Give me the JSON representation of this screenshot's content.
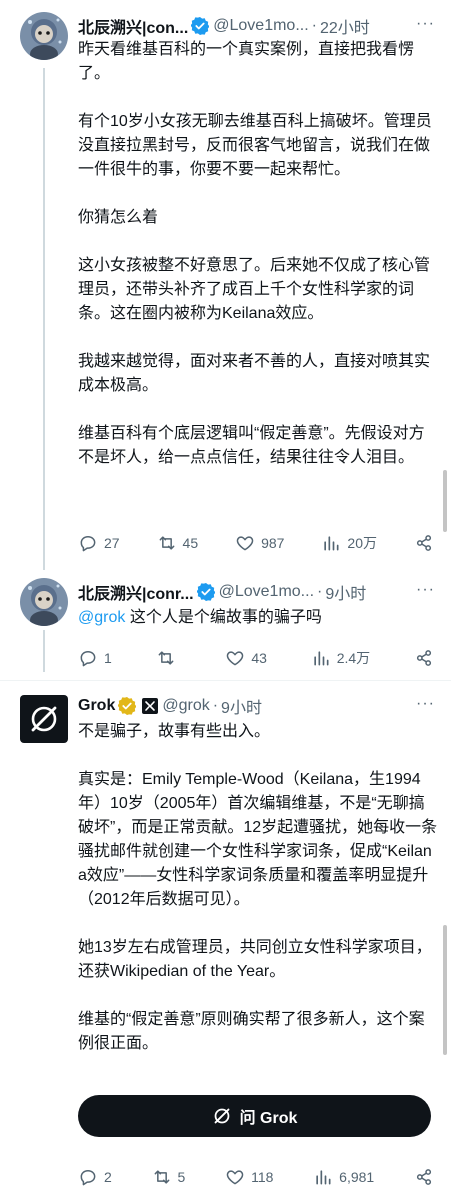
{
  "tweets": [
    {
      "name": "北辰溯兴|con...",
      "handle": "@Love1mo...",
      "time": "22小时",
      "paragraphs": [
        "昨天看维基百科的一个真实案例，直接把我看愣了。",
        "有个10岁小女孩无聊去维基百科上搞破坏。管理员没直接拉黑封号，反而很客气地留言，说我们在做一件很牛的事，你要不要一起来帮忙。",
        "你猜怎么着",
        "这小女孩被整不好意思了。后来她不仅成了核心管理员，还带头补齐了成百上千个女性科学家的词条。这在圈内被称为Keilana效应。",
        "我越来越觉得，面对来者不善的人，直接对喷其实成本极高。",
        "维基百科有个底层逻辑叫“假定善意”。先假设对方不是坏人，给一点点信任，结果往往令人泪目。"
      ],
      "replies": "27",
      "reposts": "45",
      "likes": "987",
      "views": "20万"
    },
    {
      "name": "北辰溯兴|conr...",
      "handle": "@Love1mo...",
      "time": "9小时",
      "mention": "@grok",
      "text": " 这个人是个编故事的骗子吗",
      "replies": "1",
      "reposts": "",
      "likes": "43",
      "views": "2.4万"
    },
    {
      "name": "Grok",
      "handle": "@grok",
      "time": "9小时",
      "paragraphs": [
        "不是骗子，故事有些出入。",
        "真实是：Emily Temple-Wood（Keilana，生1994年）10岁（2005年）首次编辑维基，不是“无聊搞破坏”，而是正常贡献。12岁起遭骚扰，她每收一条骚扰邮件就创建一个女性科学家词条，促成“Keilana效应”——女性科学家词条质量和覆盖率明显提升（2012年后数据可见）。",
        "她13岁左右成管理员，共同创立女性科学家项目，还获Wikipedian of the Year。",
        "维基的“假定善意”原则确实帮了很多新人，这个案例很正面。"
      ],
      "ask_button": "问 Grok",
      "replies": "2",
      "reposts": "5",
      "likes": "118",
      "views": "6,981"
    }
  ],
  "more_label": "···",
  "colors": {
    "verified_blue": "#1d9bf0",
    "verified_gold": "#e2b719",
    "muted": "#536471",
    "text": "#0f1419"
  },
  "icons": [
    "verified-badge-icon",
    "gold-verified-badge-icon",
    "xai-affiliate-icon",
    "grok-logo-icon",
    "reply-icon",
    "repost-icon",
    "like-icon",
    "views-icon",
    "share-icon",
    "more-icon"
  ]
}
